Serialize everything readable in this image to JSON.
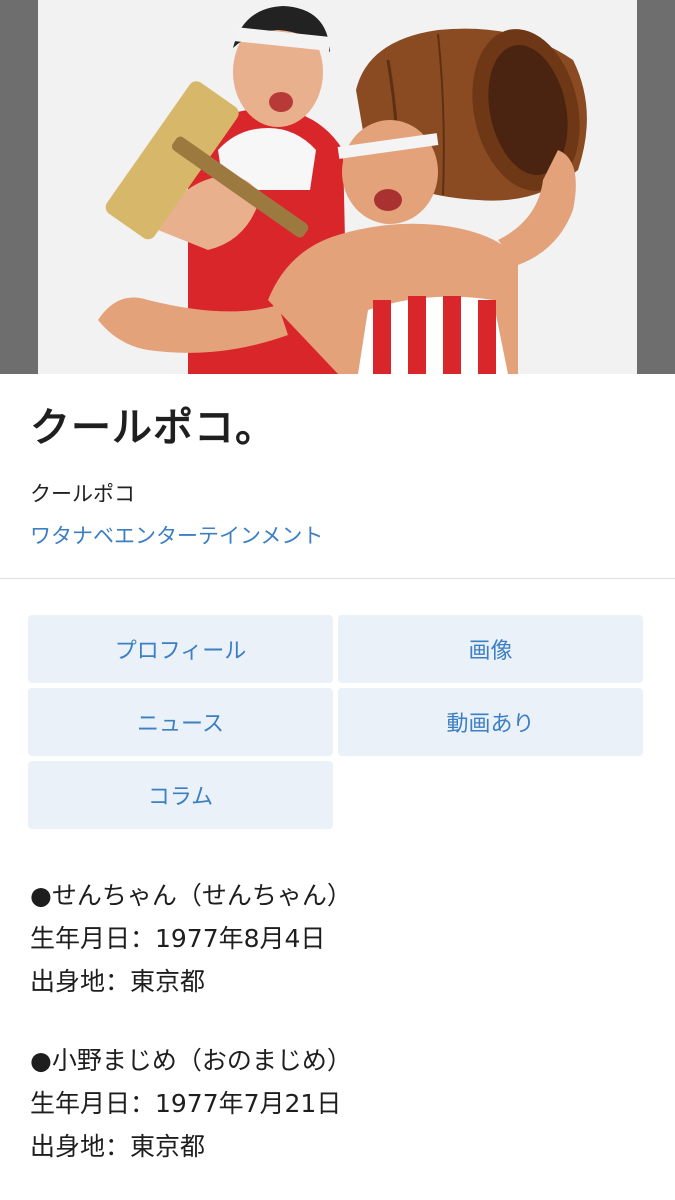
{
  "artist": {
    "name": "クールポコ。",
    "reading": "クールポコ",
    "agency": "ワタナベエンターテインメント"
  },
  "tabs": [
    {
      "label": "プロフィール"
    },
    {
      "label": "画像"
    },
    {
      "label": "ニュース"
    },
    {
      "label": "動画あり"
    },
    {
      "label": "コラム"
    }
  ],
  "members": [
    {
      "name_line": "●せんちゃん（せんちゃん）",
      "birth_line": "生年月日：1977年8月4日",
      "origin_line": "出身地：東京都"
    },
    {
      "name_line": "●小野まじめ（おのまじめ）",
      "birth_line": "生年月日：1977年7月21日",
      "origin_line": "出身地：東京都"
    }
  ],
  "colors": {
    "link": "#3c7fc3",
    "tab_bg": "#eaf1f9",
    "hero_side": "#6e6e6e"
  }
}
